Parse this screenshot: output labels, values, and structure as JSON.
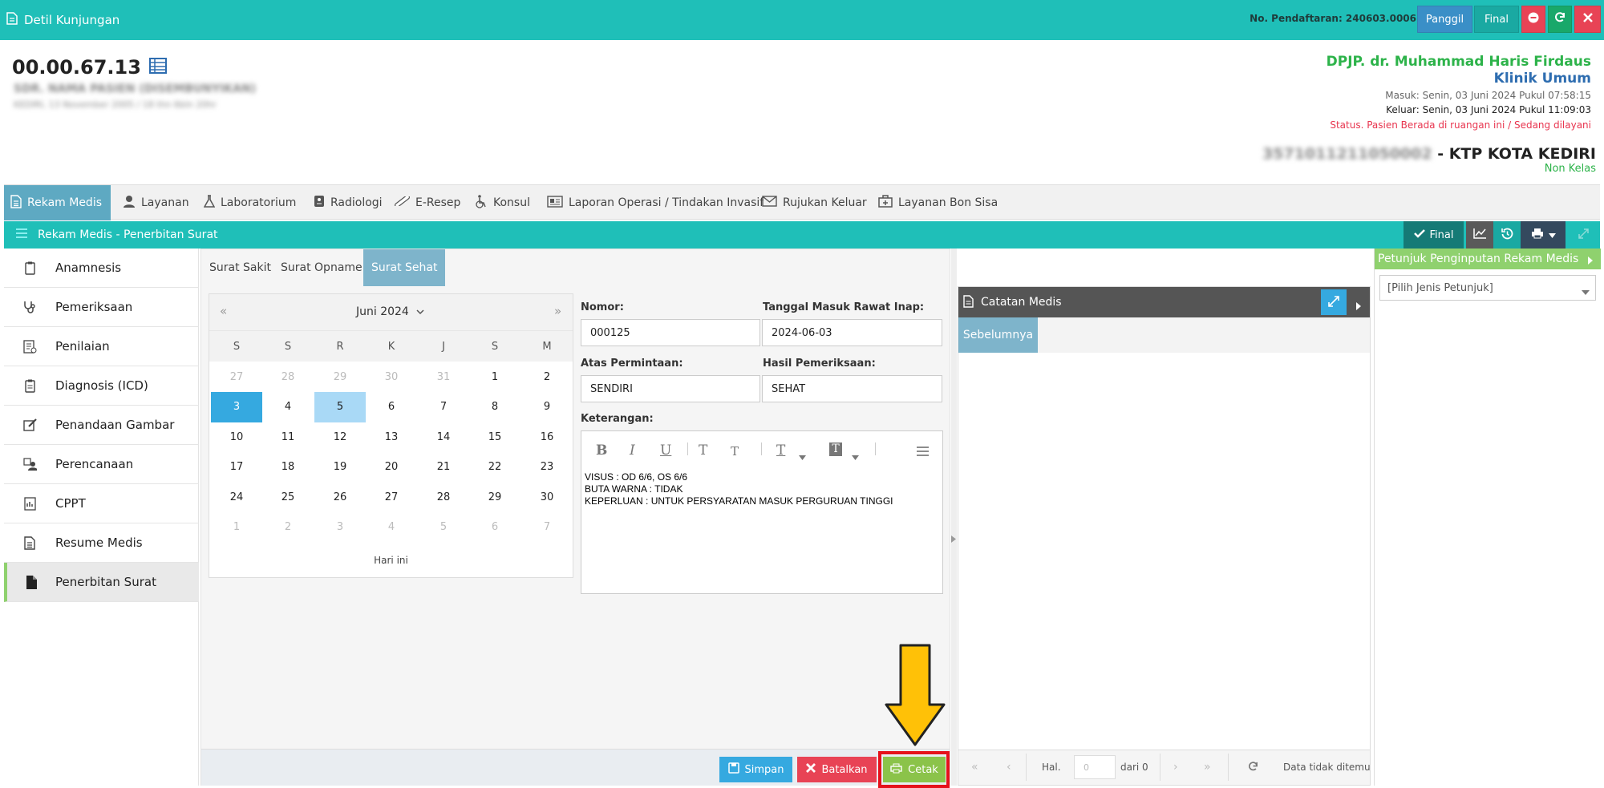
{
  "topbar": {
    "title": "Detil Kunjungan",
    "registration": "No. Pendaftaran: 240603.0006",
    "btn_call": "Panggil",
    "btn_final": "Final"
  },
  "patient": {
    "rm_number": "00.00.67.13",
    "name_blurred": "SDR. NAMA PASIEN (DISEMBUNYIKAN)",
    "dob_blurred": "KEDIRI, 13 November 2005 / 18 thn 6bln 20hr"
  },
  "visit": {
    "doctor": "DPJP. dr. Muhammad Haris Firdaus",
    "clinic": "Klinik Umum",
    "in_time": "Masuk: Senin, 03 Juni 2024 Pukul 07:58:15",
    "out_time": "Keluar: Senin, 03 Juni 2024 Pukul 11:09:03",
    "status": "Status. Pasien Berada di ruangan ini / Sedang dilayani",
    "id_blurred": "3571011211050002",
    "id_type": " - KTP KOTA KEDIRI",
    "class": "Non Kelas"
  },
  "menu": [
    "Rekam Medis",
    "Layanan",
    "Laboratorium",
    "Radiologi",
    "E-Resep",
    "Konsul",
    "Laporan Operasi / Tindakan Invasif",
    "Rujukan Keluar",
    "Layanan Bon Sisa"
  ],
  "section": {
    "title": "Rekam Medis - Penerbitan Surat",
    "final_label": "Final"
  },
  "sidebar": [
    "Anamnesis",
    "Pemeriksaan",
    "Penilaian",
    "Diagnosis (ICD)",
    "Penandaan Gambar",
    "Perencanaan",
    "CPPT",
    "Resume Medis",
    "Penerbitan Surat"
  ],
  "tabs": [
    "Surat Sakit",
    "Surat Opname",
    "Surat Sehat"
  ],
  "calendar": {
    "month_label": "Juni 2024",
    "prev": "«",
    "next": "»",
    "dow": [
      "S",
      "S",
      "R",
      "K",
      "J",
      "S",
      "M"
    ],
    "days": [
      "27",
      "28",
      "29",
      "30",
      "31",
      "1",
      "2",
      "3",
      "4",
      "5",
      "6",
      "7",
      "8",
      "9",
      "10",
      "11",
      "12",
      "13",
      "14",
      "15",
      "16",
      "17",
      "18",
      "19",
      "20",
      "21",
      "22",
      "23",
      "24",
      "25",
      "26",
      "27",
      "28",
      "29",
      "30",
      "1",
      "2",
      "3",
      "4",
      "5",
      "6",
      "7"
    ],
    "today_label": "Hari ini"
  },
  "form": {
    "nomor_label": "Nomor:",
    "nomor_value": "000125",
    "tgl_label": "Tanggal Masuk Rawat Inap:",
    "tgl_value": "2024-06-03",
    "permintaan_label": "Atas Permintaan:",
    "permintaan_value": "SENDIRI",
    "hasil_label": "Hasil Pemeriksaan:",
    "hasil_value": "SEHAT",
    "keterangan_label": "Keterangan:",
    "keterangan_text": "VISUS : OD 6/6, OS 6/6\nBUTA WARNA : TIDAK\nKEPERLUAN : UNTUK PERSYARATAN MASUK PERGURUAN TINGGI"
  },
  "editor_toolbar": {
    "bold": "B",
    "italic": "I",
    "underline": "U",
    "sup": "T",
    "sub": "T",
    "font": "T",
    "bg": "T"
  },
  "actions": {
    "save": "Simpan",
    "cancel": "Batalkan",
    "print": "Cetak"
  },
  "notes": {
    "title": "Catatan Medis",
    "tab": "Sebelumnya",
    "page_label": "Hal.",
    "page_value": "0",
    "of_label": "dari 0",
    "empty": "Data tidak ditemu"
  },
  "guide": {
    "title": "Petunjuk Penginputan Rekam Medis",
    "select": "[Pilih Jenis Petunjuk]"
  },
  "colors": {
    "teal": "#1fbfb8",
    "green": "#8fd16e",
    "blue": "#35a9e0",
    "red": "#e84355",
    "arrow": "#ffc107"
  }
}
